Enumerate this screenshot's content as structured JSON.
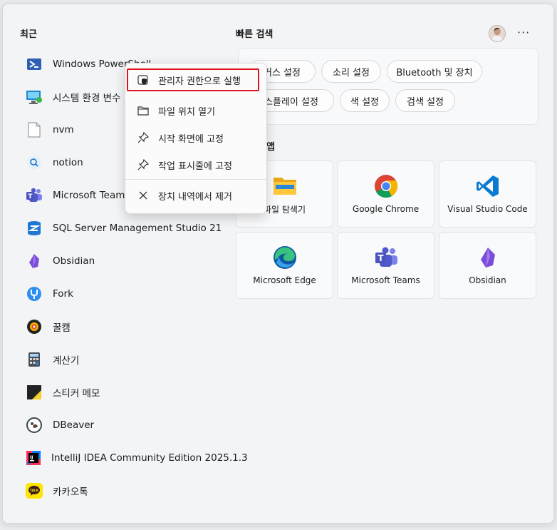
{
  "recent": {
    "title": "최근",
    "items": [
      {
        "label": "Windows PowerShell",
        "icon": "powershell-icon"
      },
      {
        "label": "시스템 환경 변수",
        "icon": "system-env-icon"
      },
      {
        "label": "nvm",
        "icon": "file-icon"
      },
      {
        "label": "notion",
        "icon": "search-icon"
      },
      {
        "label": "Microsoft Teams",
        "icon": "teams-icon"
      },
      {
        "label": "SQL Server Management Studio 21",
        "icon": "ssms-icon"
      },
      {
        "label": "Obsidian",
        "icon": "obsidian-icon"
      },
      {
        "label": "Fork",
        "icon": "fork-icon"
      },
      {
        "label": "꿀캠",
        "icon": "honeycam-icon"
      },
      {
        "label": "계산기",
        "icon": "calculator-icon"
      },
      {
        "label": "스티커 메모",
        "icon": "sticky-notes-icon"
      },
      {
        "label": "DBeaver",
        "icon": "dbeaver-icon"
      },
      {
        "label": "IntelliJ IDEA Community Edition 2025.1.3",
        "icon": "intellij-icon"
      },
      {
        "label": "카카오톡",
        "icon": "kakaotalk-icon"
      }
    ]
  },
  "quick_search": {
    "title": "빠른 검색",
    "chips": [
      "커스 설정",
      "소리 설정",
      "Bluetooth 및 장치",
      "스플레이 설정",
      "색 설정",
      "검색 설정"
    ]
  },
  "apps": {
    "title": "앱",
    "tiles": [
      {
        "label": "파일 탐색기",
        "icon": "file-explorer-icon"
      },
      {
        "label": "Google Chrome",
        "icon": "chrome-icon"
      },
      {
        "label": "Visual Studio Code",
        "icon": "vscode-icon"
      },
      {
        "label": "Microsoft Edge",
        "icon": "edge-icon"
      },
      {
        "label": "Microsoft Teams",
        "icon": "teams-icon"
      },
      {
        "label": "Obsidian",
        "icon": "obsidian-icon"
      }
    ]
  },
  "context_menu": {
    "items": [
      {
        "label": "관리자 권한으로 실행",
        "icon": "shield-icon"
      },
      {
        "label": "파일 위치 열기",
        "icon": "folder-icon"
      },
      {
        "label": "시작 화면에 고정",
        "icon": "pin-icon"
      },
      {
        "label": "작업 표시줄에 고정",
        "icon": "pin-icon"
      },
      {
        "label": "장치 내역에서 제거",
        "icon": "close-icon"
      }
    ]
  },
  "more_label": "···"
}
